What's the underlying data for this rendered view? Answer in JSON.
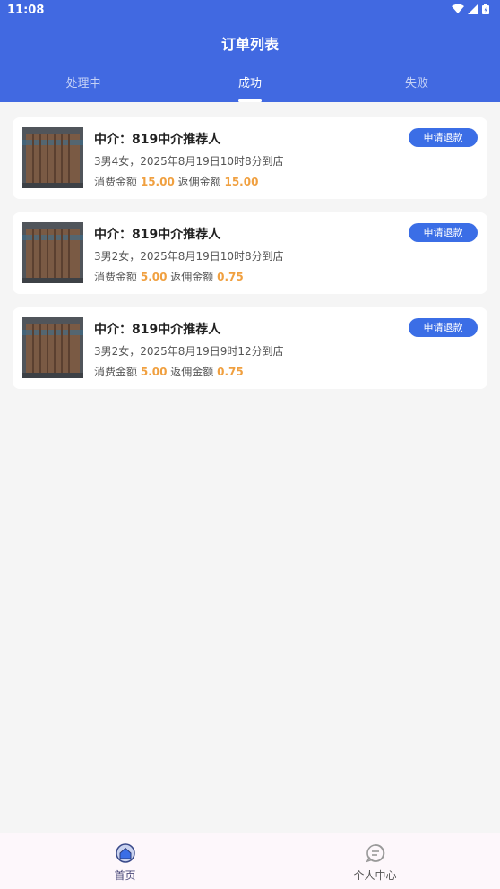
{
  "status": {
    "time": "11:08"
  },
  "header": {
    "title": "订单列表"
  },
  "tabs": [
    {
      "label": "处理中"
    },
    {
      "label": "成功"
    },
    {
      "label": "失败"
    }
  ],
  "orders": [
    {
      "title": "中介：819中介推荐人",
      "desc": "3男4女，2025年8月19日10时8分到店",
      "consume_label": "消费金额",
      "consume_value": "15.00",
      "rebate_label": "返佣金额",
      "rebate_value": "15.00",
      "button": "申请退款"
    },
    {
      "title": "中介：819中介推荐人",
      "desc": "3男2女，2025年8月19日10时8分到店",
      "consume_label": "消费金额",
      "consume_value": "5.00",
      "rebate_label": "返佣金额",
      "rebate_value": "0.75",
      "button": "申请退款"
    },
    {
      "title": "中介：819中介推荐人",
      "desc": "3男2女，2025年8月19日9时12分到店",
      "consume_label": "消费金额",
      "consume_value": "5.00",
      "rebate_label": "返佣金额",
      "rebate_value": "0.75",
      "button": "申请退款"
    }
  ],
  "bottom_nav": [
    {
      "label": "首页",
      "icon": "home-icon"
    },
    {
      "label": "个人中心",
      "icon": "chat-icon"
    }
  ],
  "colors": {
    "header": "#4169e1",
    "button": "#3b6ee6",
    "amount": "#f0a040"
  }
}
